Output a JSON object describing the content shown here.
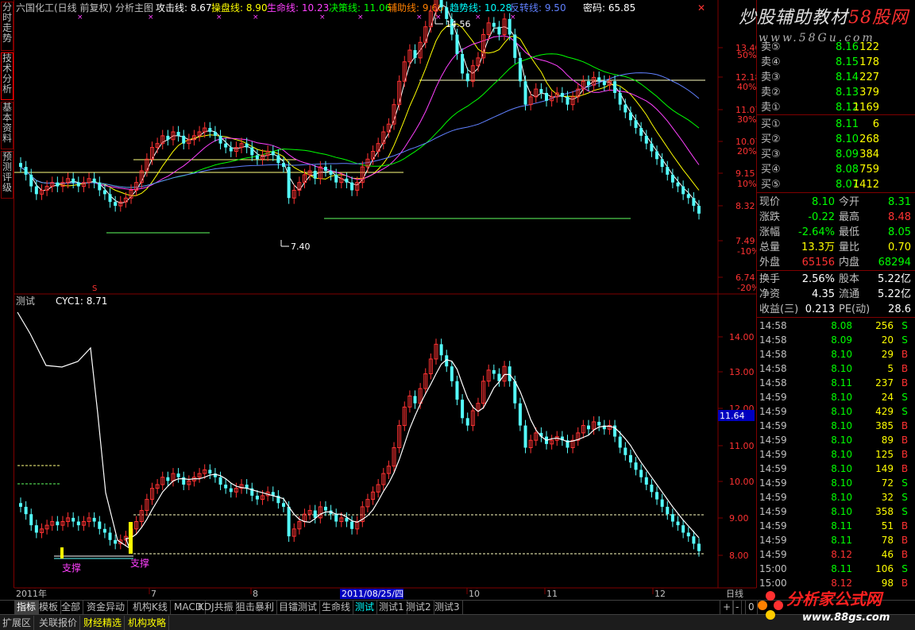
{
  "colors": {
    "up": "#ff3232",
    "down": "#54fcfc",
    "bg": "#000000",
    "grid": "#800000",
    "accent_yellow": "#ffff00",
    "accent_green": "#00ff00"
  },
  "side_tabs": [
    "分时走势",
    "技术分析",
    "基本资料",
    "预测评级"
  ],
  "main_header": {
    "title": "六国化工(日线 前复权) 分析主图",
    "indicators": [
      {
        "label": "攻击线: 8.67",
        "color": "#ffffff"
      },
      {
        "label": "操盘线: 8.90",
        "color": "#ffff00"
      },
      {
        "label": "生命线: 10.23",
        "color": "#ff40ff"
      },
      {
        "label": "决策线: 11.06",
        "color": "#00ff00"
      },
      {
        "label": "辅助线: 9.60",
        "color": "#ff8000"
      },
      {
        "label": "趋势线: 10.28",
        "color": "#00ffff"
      },
      {
        "label": "反转线: 9.50",
        "color": "#6080ff"
      },
      {
        "label": "密码: 65.85",
        "color": "#ffffff"
      }
    ]
  },
  "main_axis": {
    "prices": [
      "13.40",
      "12.18",
      "11.07",
      "10.07",
      "9.15",
      "8.32",
      "7.49",
      "6.74"
    ],
    "pcts": [
      "50%",
      "40%",
      "30%",
      "20%",
      "10%",
      "-10%",
      "-20%"
    ]
  },
  "main_annotations": {
    "high_label": "14.56",
    "low_label": "7.40",
    "marker_s": "S"
  },
  "sub_header": {
    "name": "测试",
    "value": "CYC1: 8.71"
  },
  "sub_axis": {
    "prices": [
      "14.00",
      "13.00",
      "12.00",
      "11.00",
      "10.00",
      "9.00",
      "8.00"
    ],
    "cursor_price": "11.64"
  },
  "sub_annotations": {
    "support1": "支撑",
    "support2": "支撑"
  },
  "date_axis": {
    "labels": [
      "2011年",
      "7",
      "8",
      "10",
      "11",
      "12"
    ],
    "cursor_date": "2011/08/25/四",
    "period": "日线"
  },
  "order_book": {
    "sells": [
      {
        "label": "卖⑤",
        "price": "8.16",
        "vol": "122"
      },
      {
        "label": "卖④",
        "price": "8.15",
        "vol": "178"
      },
      {
        "label": "卖③",
        "price": "8.14",
        "vol": "227"
      },
      {
        "label": "卖②",
        "price": "8.13",
        "vol": "379"
      },
      {
        "label": "卖①",
        "price": "8.12",
        "vol": "1169"
      }
    ],
    "buys": [
      {
        "label": "买①",
        "price": "8.11",
        "vol": "6"
      },
      {
        "label": "买②",
        "price": "8.10",
        "vol": "268"
      },
      {
        "label": "买③",
        "price": "8.09",
        "vol": "384"
      },
      {
        "label": "买④",
        "price": "8.08",
        "vol": "759"
      },
      {
        "label": "买⑤",
        "price": "8.07",
        "vol": "1412"
      }
    ]
  },
  "quote": {
    "rows": [
      {
        "l1": "现价",
        "v1": "8.10",
        "c1": "#00ff00",
        "l2": "今开",
        "v2": "8.31",
        "c2": "#00ff00"
      },
      {
        "l1": "涨跌",
        "v1": "-0.22",
        "c1": "#00ff00",
        "l2": "最高",
        "v2": "8.48",
        "c2": "#ff3232"
      },
      {
        "l1": "涨幅",
        "v1": "-2.64%",
        "c1": "#00ff00",
        "l2": "最低",
        "v2": "8.05",
        "c2": "#00ff00"
      },
      {
        "l1": "总量",
        "v1": "13.3万",
        "c1": "#ffff00",
        "l2": "量比",
        "v2": "0.70",
        "c2": "#ffff00"
      },
      {
        "l1": "外盘",
        "v1": "65156",
        "c1": "#ff3232",
        "l2": "内盘",
        "v2": "68294",
        "c2": "#00ff00"
      }
    ],
    "rows2": [
      {
        "l1": "换手",
        "v1": "2.56%",
        "l2": "股本",
        "v2": "5.22亿"
      },
      {
        "l1": "净资",
        "v1": "4.35",
        "l2": "流通",
        "v2": "5.22亿"
      },
      {
        "l1": "收益(三)",
        "v1": "0.213",
        "l2": "PE(动)",
        "v2": "28.6"
      }
    ]
  },
  "ticks": [
    {
      "t": "14:58",
      "p": "8.08",
      "v": "256",
      "s": "S"
    },
    {
      "t": "14:58",
      "p": "8.09",
      "v": "20",
      "s": "S"
    },
    {
      "t": "14:58",
      "p": "8.10",
      "v": "29",
      "s": "B"
    },
    {
      "t": "14:58",
      "p": "8.10",
      "v": "5",
      "s": "B"
    },
    {
      "t": "14:58",
      "p": "8.11",
      "v": "237",
      "s": "B"
    },
    {
      "t": "14:59",
      "p": "8.10",
      "v": "24",
      "s": "S"
    },
    {
      "t": "14:59",
      "p": "8.10",
      "v": "429",
      "s": "S"
    },
    {
      "t": "14:59",
      "p": "8.10",
      "v": "385",
      "s": "B"
    },
    {
      "t": "14:59",
      "p": "8.10",
      "v": "89",
      "s": "B"
    },
    {
      "t": "14:59",
      "p": "8.10",
      "v": "125",
      "s": "B"
    },
    {
      "t": "14:59",
      "p": "8.10",
      "v": "149",
      "s": "B"
    },
    {
      "t": "14:59",
      "p": "8.10",
      "v": "72",
      "s": "S"
    },
    {
      "t": "14:59",
      "p": "8.10",
      "v": "32",
      "s": "S"
    },
    {
      "t": "14:59",
      "p": "8.10",
      "v": "358",
      "s": "S"
    },
    {
      "t": "14:59",
      "p": "8.11",
      "v": "51",
      "s": "B"
    },
    {
      "t": "14:59",
      "p": "8.11",
      "v": "78",
      "s": "B"
    },
    {
      "t": "14:59",
      "p": "8.12",
      "v": "46",
      "s": "B"
    },
    {
      "t": "15:00",
      "p": "8.11",
      "v": "106",
      "s": "S"
    },
    {
      "t": "15:00",
      "p": "8.12",
      "v": "98",
      "s": "B"
    }
  ],
  "bottom_tabs": [
    "指标",
    "模板",
    "全部",
    "资金异动",
    "机构K线",
    "MACD",
    "KDJ共振",
    "狙击暴利",
    "目镭测试",
    "生命线",
    "测试",
    "测试1",
    "测试2",
    "测试3"
  ],
  "active_bottom_tab": "测试",
  "nav_buttons": [
    "+",
    "-",
    "0"
  ],
  "footer_tabs": [
    {
      "label": "扩展区",
      "color": "#c0c0c0"
    },
    {
      "label": "关联报价",
      "color": "#c0c0c0"
    },
    {
      "label": "财经精选",
      "color": "#ffff00"
    },
    {
      "label": "机构攻略",
      "color": "#ffff00"
    }
  ],
  "watermarks": {
    "top_title_a": "炒股辅助教材",
    "top_title_b": "58股网",
    "top_url": "www.58Gu.com",
    "bottom_title": "分析家公式网",
    "bottom_url": "www.88gs.com"
  }
}
